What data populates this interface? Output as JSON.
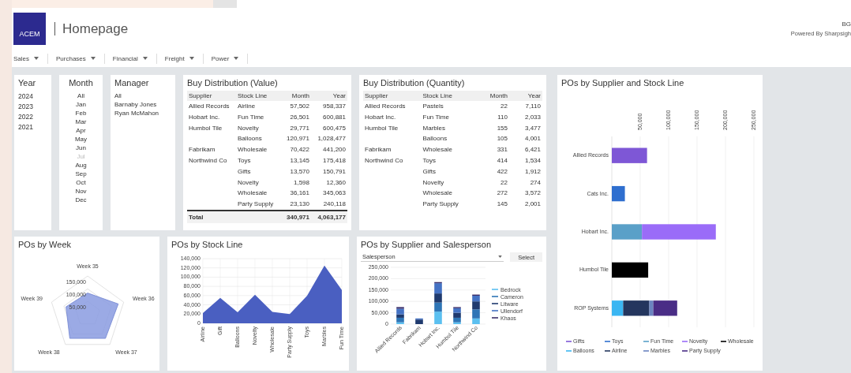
{
  "header": {
    "logo": "ACEM",
    "title": "Homepage",
    "initials": "BG",
    "powered_by": "Powered By Sharpsigh"
  },
  "nav": [
    {
      "label": "Sales"
    },
    {
      "label": "Purchases"
    },
    {
      "label": "Financial"
    },
    {
      "label": "Freight"
    },
    {
      "label": "Power"
    }
  ],
  "slicers": [
    {
      "title": "Year",
      "items": [
        {
          "label": "2024"
        },
        {
          "label": "2023"
        },
        {
          "label": "2022"
        },
        {
          "label": "2021"
        }
      ]
    },
    {
      "title": "Month",
      "items": [
        {
          "label": "All",
          "disabled": false
        },
        {
          "label": "Jan",
          "disabled": false
        },
        {
          "label": "Feb",
          "disabled": false
        },
        {
          "label": "Mar",
          "disabled": false
        },
        {
          "label": "Apr",
          "disabled": false
        },
        {
          "label": "May",
          "disabled": false
        },
        {
          "label": "Jun",
          "disabled": false
        },
        {
          "label": "Jul",
          "disabled": true
        },
        {
          "label": "Aug",
          "disabled": false
        },
        {
          "label": "Sep",
          "disabled": false
        },
        {
          "label": "Oct",
          "disabled": false
        },
        {
          "label": "Nov",
          "disabled": false
        },
        {
          "label": "Dec",
          "disabled": false
        }
      ]
    },
    {
      "title": "Manager",
      "items": [
        {
          "label": "All"
        },
        {
          "label": "Barnaby Jones"
        },
        {
          "label": "Ryan McMahon"
        }
      ]
    }
  ],
  "value_table": {
    "title": "Buy Distribution (Value)",
    "columns": [
      "Supplier",
      "Stock Line",
      "Month",
      "Year"
    ],
    "groups": [
      {
        "supplier": "Allied Records",
        "lines": [
          {
            "stock_line": "Airline",
            "month": "57,502",
            "year": "958,337"
          }
        ]
      },
      {
        "supplier": "Hobart Inc.",
        "lines": [
          {
            "stock_line": "Fun Time",
            "month": "26,501",
            "year": "600,881"
          }
        ]
      },
      {
        "supplier": "Humbol Tile",
        "lines": [
          {
            "stock_line": "Novelty",
            "month": "29,771",
            "year": "600,475"
          },
          {
            "stock_line": "Balloons",
            "month": "120,971",
            "year": "1,028,477"
          }
        ]
      },
      {
        "supplier": "Fabrikam",
        "lines": [
          {
            "stock_line": "Wholesale",
            "month": "70,422",
            "year": "441,200"
          }
        ]
      },
      {
        "supplier": "Northwind Co",
        "lines": [
          {
            "stock_line": "Toys",
            "month": "13,145",
            "year": "175,418"
          },
          {
            "stock_line": "Gifts",
            "month": "13,570",
            "year": "150,791"
          },
          {
            "stock_line": "Novelty",
            "month": "1,598",
            "year": "12,360"
          },
          {
            "stock_line": "Wholesale",
            "month": "36,161",
            "year": "345,063"
          },
          {
            "stock_line": "Party Supply",
            "month": "23,130",
            "year": "240,118"
          }
        ]
      }
    ],
    "total": {
      "label": "Total",
      "month": "340,971",
      "year": "4,063,177"
    }
  },
  "quantity_table": {
    "title": "Buy Distribution (Quantity)",
    "columns": [
      "Supplier",
      "Stock Line",
      "Month",
      "Year"
    ],
    "groups": [
      {
        "supplier": "Allied Records",
        "lines": [
          {
            "stock_line": "Pastels",
            "month": "22",
            "year": "7,110"
          }
        ]
      },
      {
        "supplier": "Hobart Inc.",
        "lines": [
          {
            "stock_line": "Fun Time",
            "month": "110",
            "year": "2,033"
          }
        ]
      },
      {
        "supplier": "Humbol Tile",
        "lines": [
          {
            "stock_line": "Marbles",
            "month": "155",
            "year": "3,477"
          },
          {
            "stock_line": "Balloons",
            "month": "105",
            "year": "4,001"
          }
        ]
      },
      {
        "supplier": "Fabrikam",
        "lines": [
          {
            "stock_line": "Wholesale",
            "month": "331",
            "year": "6,421"
          }
        ]
      },
      {
        "supplier": "Northwind Co",
        "lines": [
          {
            "stock_line": "Toys",
            "month": "414",
            "year": "1,534"
          },
          {
            "stock_line": "Gifts",
            "month": "422",
            "year": "1,912"
          },
          {
            "stock_line": "Novelty",
            "month": "22",
            "year": "274"
          },
          {
            "stock_line": "Wholesale",
            "month": "272",
            "year": "3,572"
          },
          {
            "stock_line": "Party Supply",
            "month": "145",
            "year": "2,001"
          }
        ]
      }
    ]
  },
  "week_chart": {
    "title": "POs by Week",
    "axis_labels": [
      "Week 35",
      "Week 36",
      "Week 37",
      "Week 38",
      "Week 39"
    ],
    "tick_labels": [
      "150,000",
      "100,000",
      "50,000"
    ]
  },
  "stock_line_chart": {
    "title": "POs by Stock Line",
    "chart_data": {
      "type": "area",
      "categories": [
        "Airline",
        "Gift",
        "Balloons",
        "Novelty",
        "Wholesale",
        "Party Supply",
        "Toys",
        "Marbles",
        "Fun Time"
      ],
      "ylim": [
        0,
        140000
      ],
      "yticks": [
        {
          "value": 0,
          "label": "0"
        },
        {
          "value": 20000,
          "label": "20,000"
        },
        {
          "value": 40000,
          "label": "40,000"
        },
        {
          "value": 60000,
          "label": "60,000"
        },
        {
          "value": 80000,
          "label": "80,000"
        },
        {
          "value": 100000,
          "label": "100,000"
        },
        {
          "value": 120000,
          "label": "120,000"
        },
        {
          "value": 140000,
          "label": "140,000"
        }
      ],
      "grid": true,
      "series": [
        {
          "color": "#4a5fc1",
          "values": [
            22000,
            55000,
            24000,
            62000,
            25000,
            20000,
            60000,
            125000,
            72000
          ]
        }
      ]
    }
  },
  "sales_chart": {
    "title": "POs by Supplier and Salesperson",
    "slicer": {
      "value": "Salesperson",
      "button": "Select"
    },
    "chart_data": {
      "type": "bar",
      "stacked": true,
      "categories": [
        "Allied Records",
        "Fabrikam",
        "Hobart Inc.",
        "Humbol Tile",
        "Northwind Co"
      ],
      "ylim": [
        0,
        250000
      ],
      "grid": true,
      "legend": true,
      "yticks": [
        {
          "value": 0,
          "label": "0"
        },
        {
          "value": 50000,
          "label": "50,000"
        },
        {
          "value": 100000,
          "label": "100,000"
        },
        {
          "value": 150000,
          "label": "150,000"
        },
        {
          "value": 200000,
          "label": "200,000"
        },
        {
          "value": 250000,
          "label": "250,000"
        }
      ],
      "series": [
        {
          "name": "Bedrock",
          "color": "#5bc0f0",
          "values": [
            8000,
            null,
            55000,
            8000,
            25000
          ]
        },
        {
          "name": "Cameron",
          "color": "#2e75b6",
          "values": [
            20000,
            null,
            40000,
            20000,
            40000
          ]
        },
        {
          "name": "Litware",
          "color": "#1f3a6e",
          "values": [
            15000,
            20000,
            40000,
            22000,
            35000
          ]
        },
        {
          "name": "Ullendorf",
          "color": "#4472c4",
          "values": [
            25000,
            5000,
            45000,
            20000,
            25000
          ]
        },
        {
          "name": "Khaos",
          "color": "#3b2f6b",
          "values": [
            7000,
            null,
            5000,
            5000,
            5000
          ]
        }
      ]
    }
  },
  "supplier_stock_chart": {
    "title": "POs by Supplier and Stock Line",
    "chart_data": {
      "type": "bar",
      "stacked": true,
      "orientation": "horizontal",
      "categories": [
        "Allied Records",
        "Cats Inc.",
        "Hobart Inc.",
        "Humbol Tile",
        "ROP Systems"
      ],
      "xlim": [
        0,
        250000
      ],
      "grid": true,
      "legend": true,
      "xticks": [
        {
          "value": 50000,
          "label": "50,000"
        },
        {
          "value": 100000,
          "label": "100,000"
        },
        {
          "value": 150000,
          "label": "150,000"
        },
        {
          "value": 200000,
          "label": "200,000"
        },
        {
          "value": 250000,
          "label": "250,000"
        }
      ],
      "series": [
        {
          "name": "Gifts",
          "color": "#7e57d6",
          "values": [
            62000,
            null,
            null,
            null,
            null
          ]
        },
        {
          "name": "Toys",
          "color": "#2f6fcf",
          "values": [
            null,
            23000,
            null,
            null,
            null
          ]
        },
        {
          "name": "Fun Time",
          "color": "#5aa0c8",
          "values": [
            null,
            null,
            53000,
            null,
            null
          ]
        },
        {
          "name": "Novelty",
          "color": "#9a6cf8",
          "values": [
            null,
            null,
            130000,
            null,
            null
          ]
        },
        {
          "name": "Wholesale",
          "color": "#000000",
          "values": [
            null,
            null,
            null,
            64000,
            null
          ]
        },
        {
          "name": "Balloons",
          "color": "#3bb6f2",
          "values": [
            null,
            null,
            null,
            null,
            20000
          ]
        },
        {
          "name": "Airline",
          "color": "#24365e",
          "values": [
            null,
            null,
            null,
            null,
            46000
          ]
        },
        {
          "name": "Marbles",
          "color": "#6b84c0",
          "values": [
            null,
            null,
            null,
            null,
            7000
          ]
        },
        {
          "name": "Party Supply",
          "color": "#4a2d86",
          "values": [
            null,
            null,
            null,
            null,
            42000
          ]
        }
      ]
    }
  }
}
